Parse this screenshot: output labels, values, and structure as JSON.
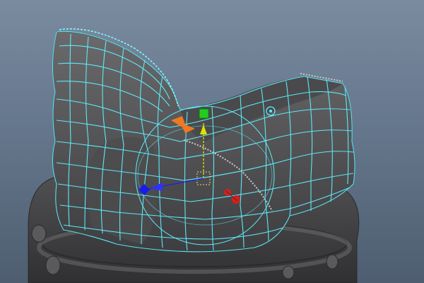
{
  "viewport": {
    "background_top": "#7a8ba0",
    "background_bottom": "#4e5e70"
  },
  "mesh": {
    "surface_color": "#5a5a5c",
    "wire_color": "#5ff0ff",
    "selection_wire_color": "#8affff"
  },
  "manipulator": {
    "type": "move-rotate-scale",
    "axis_colors": {
      "x": "#e85a2a",
      "y": "#d4d000",
      "z": "#1a1aff",
      "handle_green": "#22cc22",
      "handle_red": "#cc2222",
      "ring": "#5ff0ff"
    }
  },
  "icons": [
    "pivot-icon",
    "move-manipulator-icon",
    "rotate-ring-icon"
  ]
}
